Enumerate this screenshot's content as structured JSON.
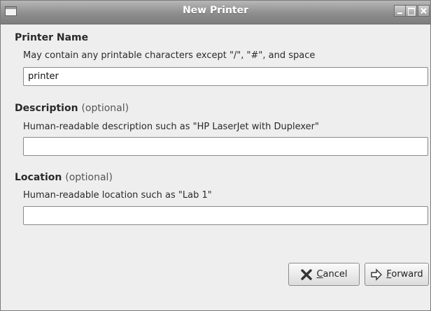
{
  "window": {
    "title": "New Printer"
  },
  "printer_name": {
    "heading": "Printer Name",
    "hint": "May contain any printable characters except \"/\", \"#\", and space",
    "value": "printer"
  },
  "description": {
    "heading": "Description",
    "optional_tag": "(optional)",
    "hint": "Human-readable description such as \"HP LaserJet with Duplexer\"",
    "value": ""
  },
  "location": {
    "heading": "Location",
    "optional_tag": "(optional)",
    "hint": "Human-readable location such as \"Lab 1\"",
    "value": ""
  },
  "buttons": {
    "cancel_first": "C",
    "cancel_rest": "ancel",
    "forward_first": "F",
    "forward_rest": "orward"
  },
  "colors": {
    "titlebar": "#8e8e8e",
    "window_bg": "#eeeeee"
  }
}
